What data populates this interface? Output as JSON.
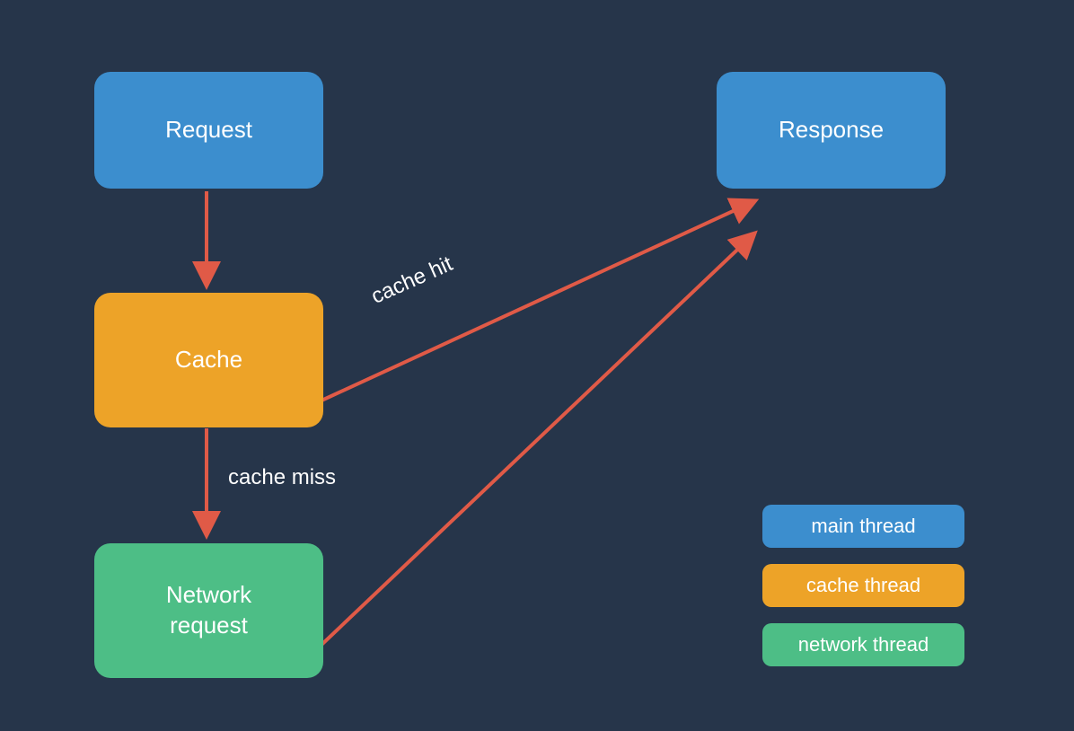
{
  "nodes": {
    "request": {
      "label": "Request"
    },
    "cache": {
      "label": "Cache"
    },
    "network": {
      "label": "Network\nrequest"
    },
    "response": {
      "label": "Response"
    }
  },
  "edges": {
    "request_to_cache": {
      "label": ""
    },
    "cache_to_network": {
      "label": "cache miss"
    },
    "cache_to_response": {
      "label": "cache hit"
    },
    "network_to_response": {
      "label": ""
    }
  },
  "legend": {
    "main": {
      "label": "main thread"
    },
    "cache": {
      "label": "cache thread"
    },
    "network": {
      "label": "network thread"
    }
  },
  "colors": {
    "blue": "#3c8ece",
    "orange": "#eda328",
    "green": "#4dbe86",
    "arrow": "#e05a47",
    "bg": "#26354a",
    "text": "#ffffff"
  }
}
